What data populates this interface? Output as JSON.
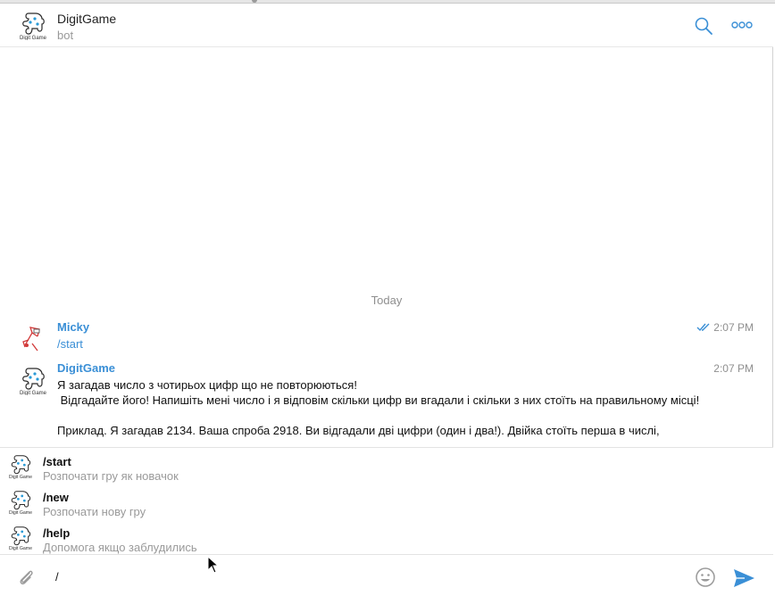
{
  "header": {
    "title": "DigitGame",
    "subtitle": "bot",
    "avatar_text": "Digit Game"
  },
  "messages": {
    "date_separator": "Today",
    "items": [
      {
        "author": "Micky",
        "text": "/start",
        "time": "2:07 PM",
        "read": true
      },
      {
        "author": "DigitGame",
        "text": "Я загадав число з чотирьох цифр що не повторюються!\n Відгадайте його! Напишіть мені число і я відповім скільки цифр ви вгадали і скільки з них стоїть на правильному місці!\n\nПриклад. Я загадав 2134. Ваша спроба 2918. Ви відгадали дві цифри (один і два!). Двійка стоїть перша в числі,",
        "time": "2:07 PM"
      }
    ]
  },
  "commands": [
    {
      "name": "/start",
      "description": "Розпочати гру як новачок"
    },
    {
      "name": "/new",
      "description": "Розпочати нову гру"
    },
    {
      "name": "/help",
      "description": "Допомога якщо заблудились"
    }
  ],
  "composer": {
    "value": "/"
  },
  "colors": {
    "accent": "#3a8fd6",
    "muted": "#999999"
  },
  "icons": {
    "search": "search-icon",
    "more": "more-icon",
    "attach": "paperclip-icon",
    "emoji": "smiley-icon",
    "send": "send-icon",
    "read": "double-check-icon"
  }
}
